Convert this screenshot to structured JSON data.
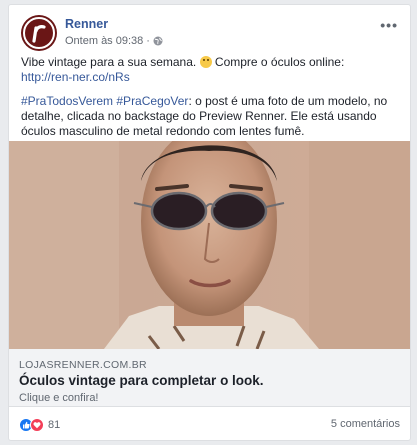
{
  "post": {
    "page_name": "Renner",
    "timestamp": "Ontem às 09:38",
    "separator": "·",
    "privacy_icon": "globe-icon",
    "more_label": "•••",
    "line1_a": "Vibe vintage para a sua semana. ",
    "line1_b": " Compre o óculos online: ",
    "url": "http://ren-ner.co/nRs",
    "hashtags": "#PraTodosVerem #PraCegoVer",
    "description": ": o post é uma foto de um modelo, no detalhe, clicada no backstage do Preview Renner. Ele está usando óculos masculino de metal redondo com lentes fumê."
  },
  "link_preview": {
    "domain": "LOJASRENNER.COM.BR",
    "title": "Óculos vintage para completar o look.",
    "subtitle": "Clique e confira!"
  },
  "footer": {
    "reaction_count": "81",
    "comments": "5 comentários"
  },
  "colors": {
    "link": "#365899",
    "brand": "#6a1616",
    "like": "#1877f2",
    "love": "#f33e58"
  }
}
